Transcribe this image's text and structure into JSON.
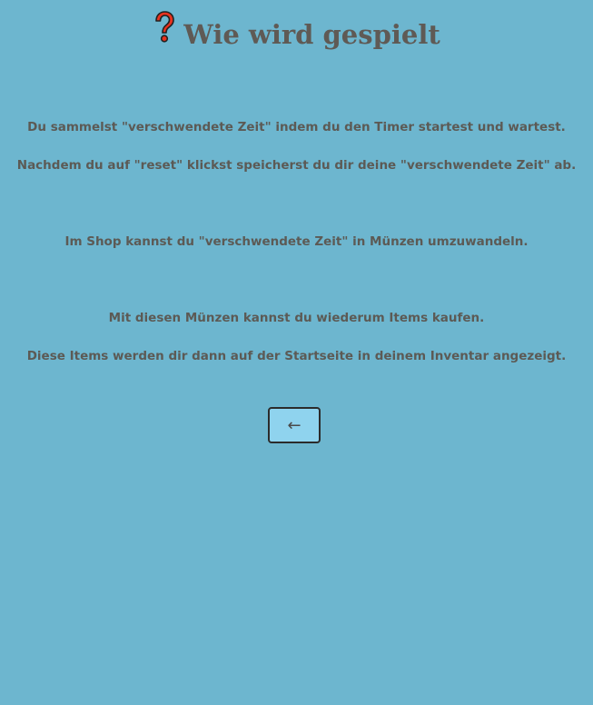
{
  "header": {
    "icon": "question-mark-icon",
    "title": "Wie wird gespielt"
  },
  "instructions": [
    "Du sammelst \"verschwendete Zeit\" indem du den Timer startest und wartest.",
    "Nachdem du auf \"reset\" klickst speicherst du dir deine \"verschwendete Zeit\" ab.",
    "Im Shop kannst du \"verschwendete Zeit\" in Münzen umzuwandeln.",
    "Mit diesen Münzen kannst du wiederum Items kaufen.",
    "Diese Items werden dir dann auf der Startseite in deinem Inventar angezeigt."
  ],
  "back_button": {
    "label": "←"
  },
  "colors": {
    "background": "#6db6cf",
    "text": "#5c5a55",
    "button_bg": "#8fd3ee",
    "icon_red": "#e8321e"
  }
}
